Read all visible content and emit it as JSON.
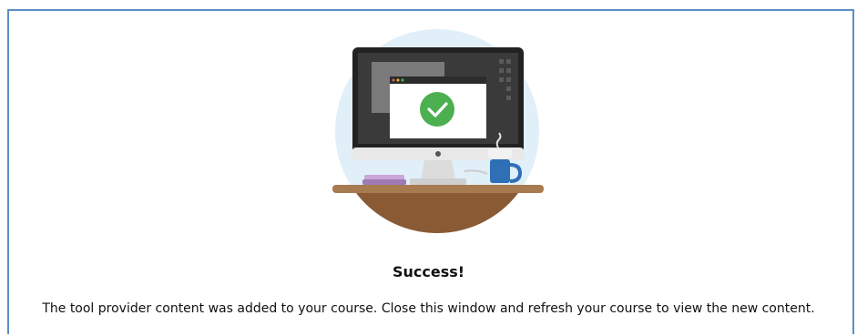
{
  "dialog": {
    "illustration": "computer-success-illustration",
    "status_icon": "checkmark-icon",
    "title": "Success!",
    "message": "The tool provider content was added to your course. Close this window and refresh your course to view the new content."
  },
  "colors": {
    "frame_border": "#5b8fc7",
    "success_green": "#4caf50",
    "desk_brown": "#8a5a34",
    "circle_bg": "#e1eff9",
    "mug_blue": "#2f6fb6"
  }
}
